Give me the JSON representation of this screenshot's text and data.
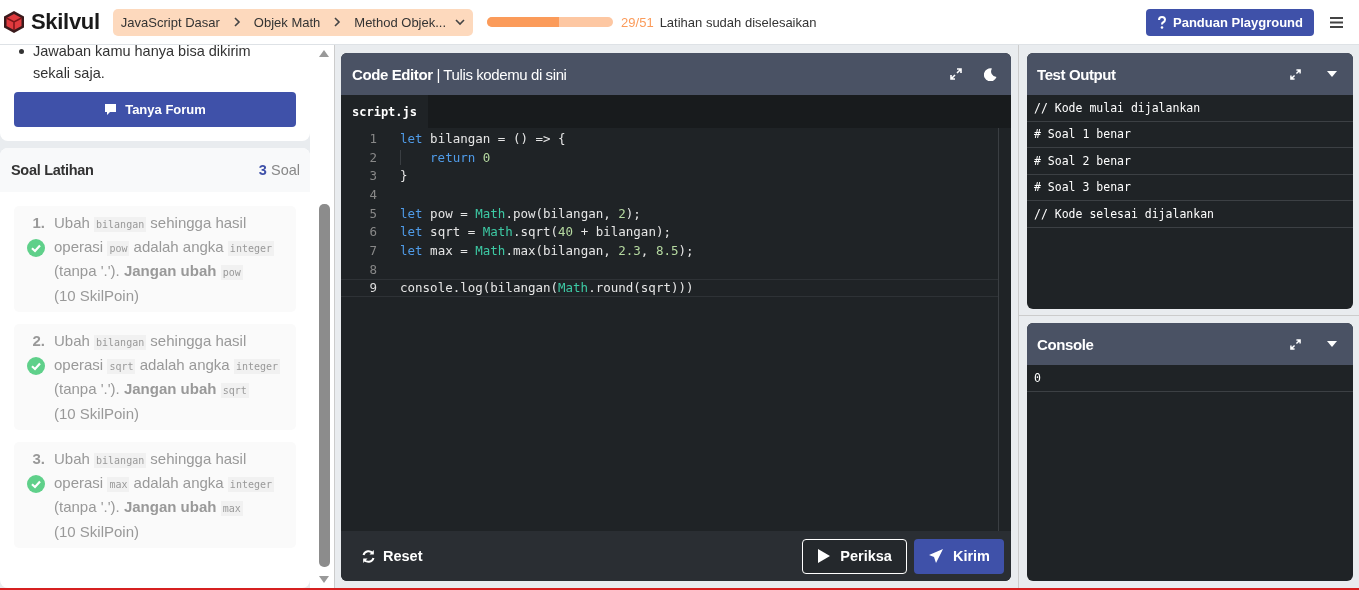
{
  "header": {
    "logo": "Skilvul",
    "breadcrumbs": [
      "JavaScript Dasar",
      "Objek Math",
      "Method Objek..."
    ],
    "progress": {
      "level": 0.569,
      "count": "29/51",
      "label": "Latihan sudah diselesaikan"
    },
    "guide_button": "Panduan Playground"
  },
  "instructions": {
    "bullets": [
      "Jawaban kamu hanya bisa dikirim sekali saja."
    ],
    "forum_button": "Tanya Forum"
  },
  "exercises": {
    "title": "Soal Latihan",
    "count": "3",
    "count_unit": "Soal",
    "items": [
      {
        "number": "1.",
        "done": true,
        "points": "(10 SkilPoin)",
        "segments": [
          {
            "kind": "text",
            "text": "Ubah "
          },
          {
            "kind": "code",
            "text": "bilangan"
          },
          {
            "kind": "text",
            "text": " sehingga hasil operasi "
          },
          {
            "kind": "code",
            "text": "pow"
          },
          {
            "kind": "text",
            "text": " adalah angka "
          },
          {
            "kind": "code",
            "text": "integer"
          },
          {
            "kind": "text",
            "text": " (tanpa '.'). "
          },
          {
            "kind": "bold",
            "text": "Jangan ubah "
          },
          {
            "kind": "code",
            "text": "pow"
          }
        ]
      },
      {
        "number": "2.",
        "done": true,
        "points": "(10 SkilPoin)",
        "segments": [
          {
            "kind": "text",
            "text": "Ubah "
          },
          {
            "kind": "code",
            "text": "bilangan"
          },
          {
            "kind": "text",
            "text": " sehingga hasil operasi "
          },
          {
            "kind": "code",
            "text": "sqrt"
          },
          {
            "kind": "text",
            "text": " adalah angka "
          },
          {
            "kind": "code",
            "text": "integer"
          },
          {
            "kind": "text",
            "text": " (tanpa '.'). "
          },
          {
            "kind": "bold",
            "text": "Jangan ubah "
          },
          {
            "kind": "code",
            "text": "sqrt"
          }
        ]
      },
      {
        "number": "3.",
        "done": true,
        "points": "(10 SkilPoin)",
        "segments": [
          {
            "kind": "text",
            "text": "Ubah "
          },
          {
            "kind": "code",
            "text": "bilangan"
          },
          {
            "kind": "text",
            "text": " sehingga hasil operasi "
          },
          {
            "kind": "code",
            "text": "max"
          },
          {
            "kind": "text",
            "text": " adalah angka "
          },
          {
            "kind": "code",
            "text": "integer"
          },
          {
            "kind": "text",
            "text": " (tanpa '.'). "
          },
          {
            "kind": "bold",
            "text": "Jangan ubah "
          },
          {
            "kind": "code",
            "text": "max"
          }
        ]
      }
    ]
  },
  "editor": {
    "title": "Code Editor",
    "separator": "|",
    "subtitle": "Tulis kodemu di sini",
    "file_tab": {
      "label": "script.js",
      "selected": true
    },
    "lines": [
      {
        "number": "1",
        "active": false,
        "indented": false,
        "tokens": [
          {
            "kind": "keyword",
            "text": "let"
          },
          {
            "kind": "plain",
            "text": " bilangan = () => {"
          }
        ]
      },
      {
        "number": "2",
        "active": false,
        "indented": true,
        "tokens": [
          {
            "kind": "keyword",
            "text": "return "
          },
          {
            "kind": "number",
            "text": "0"
          }
        ]
      },
      {
        "number": "3",
        "active": false,
        "indented": false,
        "tokens": [
          {
            "kind": "plain",
            "text": "}"
          }
        ]
      },
      {
        "number": "4",
        "active": false
      },
      {
        "number": "5",
        "active": false,
        "indented": false,
        "tokens": [
          {
            "kind": "keyword",
            "text": "let"
          },
          {
            "kind": "plain",
            "text": " pow = "
          },
          {
            "kind": "builtin",
            "text": "Math"
          },
          {
            "kind": "plain",
            "text": ".pow(bilangan, "
          },
          {
            "kind": "number",
            "text": "2"
          },
          {
            "kind": "plain",
            "text": ");"
          }
        ]
      },
      {
        "number": "6",
        "active": false,
        "indented": false,
        "tokens": [
          {
            "kind": "keyword",
            "text": "let"
          },
          {
            "kind": "plain",
            "text": " sqrt = "
          },
          {
            "kind": "builtin",
            "text": "Math"
          },
          {
            "kind": "plain",
            "text": ".sqrt("
          },
          {
            "kind": "number",
            "text": "40"
          },
          {
            "kind": "plain",
            "text": " + bilangan);"
          }
        ]
      },
      {
        "number": "7",
        "active": false,
        "indented": false,
        "tokens": [
          {
            "kind": "keyword",
            "text": "let"
          },
          {
            "kind": "plain",
            "text": " max = "
          },
          {
            "kind": "builtin",
            "text": "Math"
          },
          {
            "kind": "plain",
            "text": ".max(bilangan, "
          },
          {
            "kind": "number",
            "text": "2.3"
          },
          {
            "kind": "plain",
            "text": ", "
          },
          {
            "kind": "number",
            "text": "8.5"
          },
          {
            "kind": "plain",
            "text": ");"
          }
        ]
      },
      {
        "number": "8",
        "active": false
      },
      {
        "number": "9",
        "active": true,
        "indented": false,
        "tokens": [
          {
            "kind": "plain",
            "text": "console.log(bilangan("
          },
          {
            "kind": "builtin",
            "text": "Math"
          },
          {
            "kind": "plain",
            "text": ".round(sqrt)))"
          }
        ]
      }
    ],
    "reset_button": "Reset",
    "check_button": "Periksa",
    "submit_button": "Kirim"
  },
  "test_output": {
    "title": "Test Output",
    "lines": [
      "// Kode mulai dijalankan",
      "# Soal 1 benar",
      "# Soal 2 benar",
      "# Soal 3 benar",
      "// Kode selesai dijalankan"
    ]
  },
  "console": {
    "title": "Console",
    "lines": [
      "0"
    ]
  }
}
